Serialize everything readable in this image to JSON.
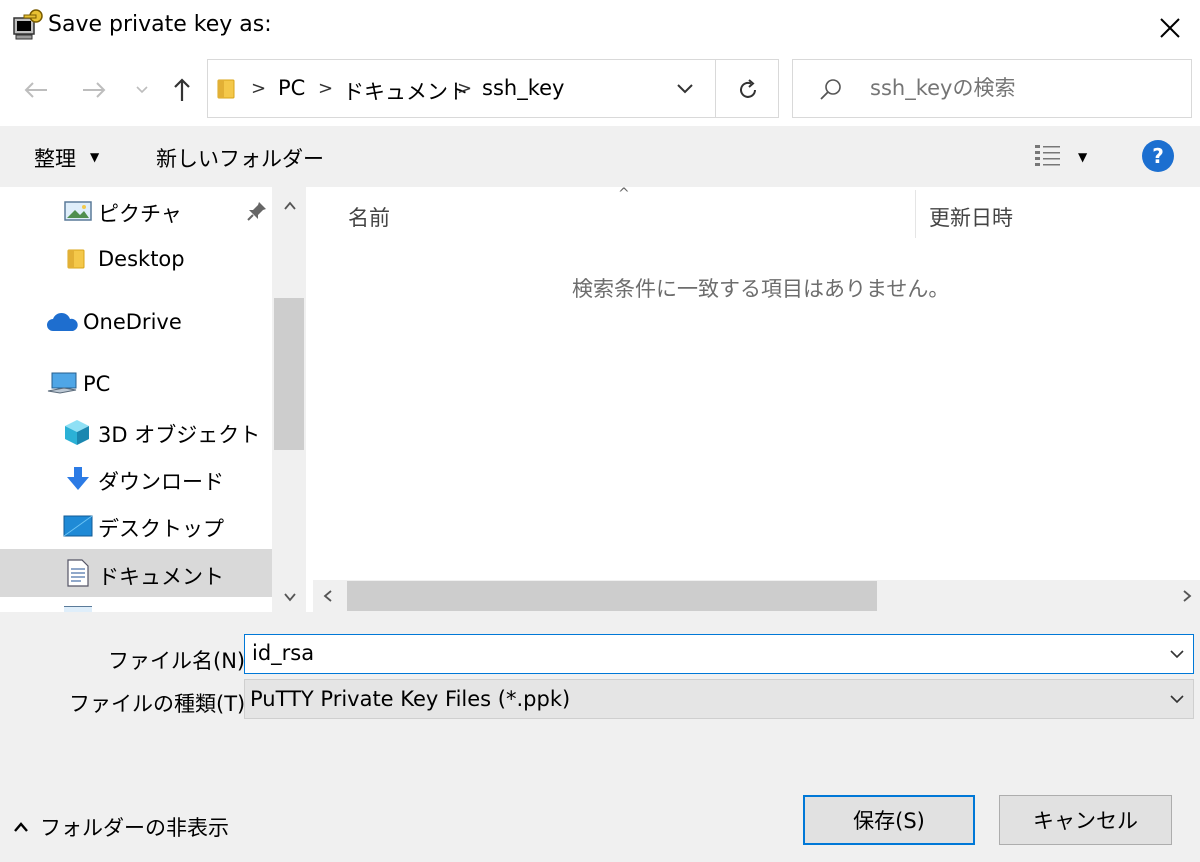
{
  "window": {
    "title": "Save private key as:"
  },
  "nav": {
    "breadcrumbs": [
      "PC",
      "ドキュメント",
      "ssh_key"
    ],
    "search_placeholder": "ssh_keyの検索"
  },
  "toolbar": {
    "organize_label": "整理",
    "new_folder_label": "新しいフォルダー",
    "help_label": "?"
  },
  "sidebar": {
    "items": [
      {
        "label": "ピクチャ",
        "icon": "pictures-icon",
        "pinned": true
      },
      {
        "label": "Desktop",
        "icon": "folder-icon"
      },
      {
        "label": "OneDrive",
        "icon": "onedrive-cloud-icon"
      },
      {
        "label": "PC",
        "icon": "pc-icon"
      },
      {
        "label": "3D オブジェクト",
        "icon": "3d-objects-icon"
      },
      {
        "label": "ダウンロード",
        "icon": "download-icon"
      },
      {
        "label": "デスクトップ",
        "icon": "desktop-icon"
      },
      {
        "label": "ドキュメント",
        "icon": "documents-icon",
        "selected": true
      }
    ]
  },
  "file_list": {
    "columns": [
      "名前",
      "更新日時"
    ],
    "empty_message": "検索条件に一致する項目はありません。"
  },
  "form": {
    "filename_label": "ファイル名(N):",
    "filename_value": "id_rsa",
    "filetype_label": "ファイルの種類(T):",
    "filetype_value": "PuTTY Private Key Files (*.ppk)"
  },
  "footer": {
    "hide_folders_label": "フォルダーの非表示",
    "save_label": "保存(S)",
    "cancel_label": "キャンセル"
  },
  "colors": {
    "accent": "#0078d7",
    "help_blue": "#1c6fd0",
    "panel_gray": "#f0f0f0",
    "selected_gray": "#d9d9d9"
  }
}
